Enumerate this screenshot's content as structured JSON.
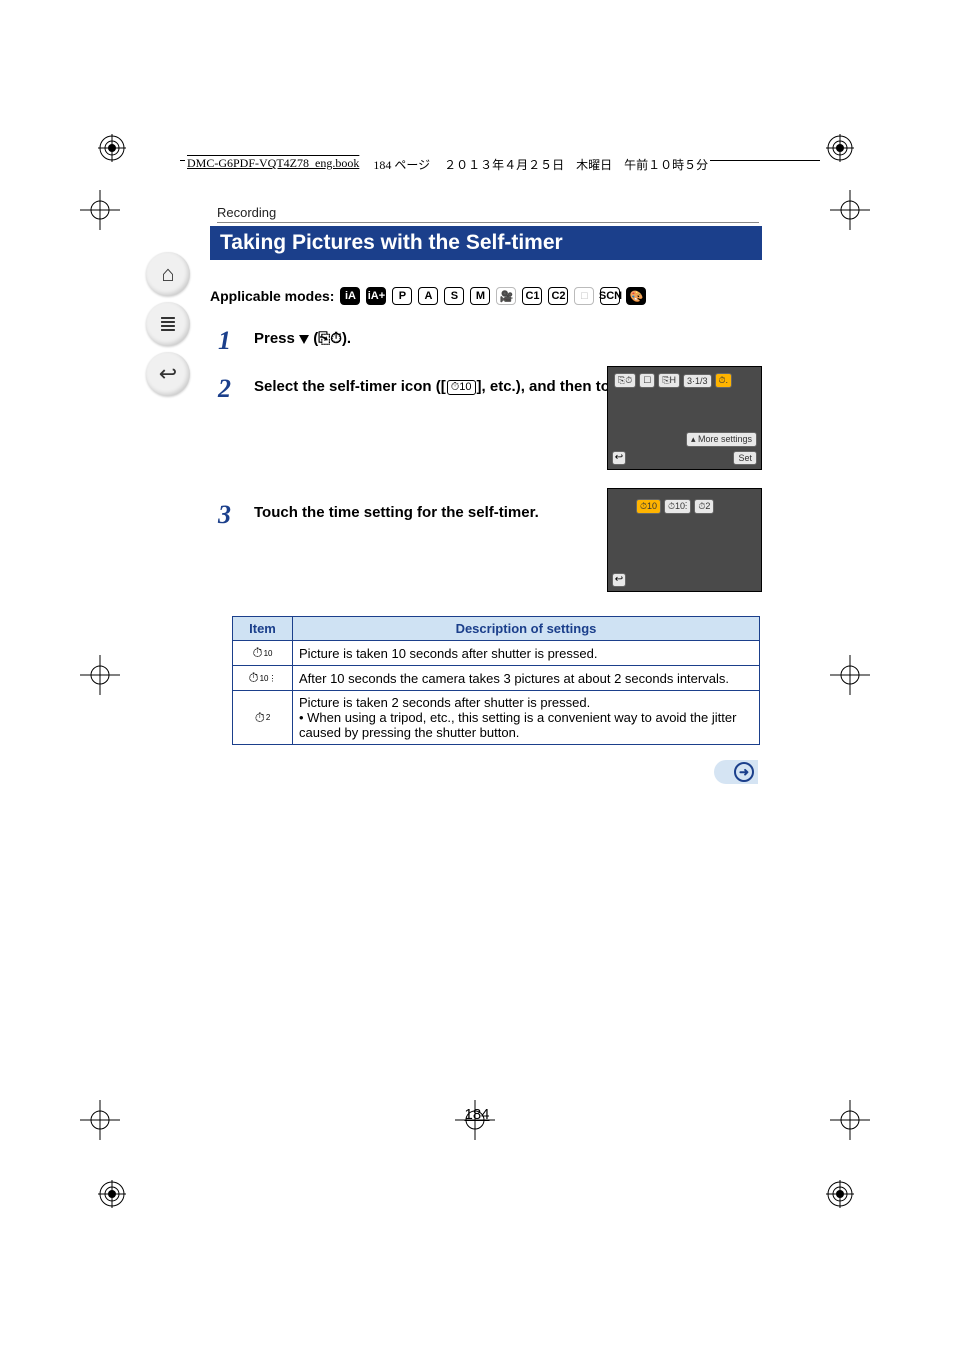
{
  "header": {
    "filename": "DMC-G6PDF-VQT4Z78_eng.book",
    "page_jp": "184 ページ",
    "date_jp": "２０１３年４月２５日　木曜日　午前１０時５分"
  },
  "breadcrumb": "Recording",
  "title": "Taking Pictures with the Self-timer",
  "modes_label": "Applicable modes:",
  "mode_chips": [
    "iA",
    "iA+",
    "P",
    "A",
    "S",
    "M",
    "🎥",
    "C1",
    "C2",
    "□",
    "SCN",
    "🎨"
  ],
  "steps": {
    "s1": {
      "num": "1",
      "text_pre": "Press ",
      "text_post": " (",
      "chip_burst": "⎘",
      "chip_timer": "⏱",
      "text_end": ")."
    },
    "s2": {
      "num": "2",
      "text_pre": "Select the self-timer icon ([",
      "chip": "⏱10",
      "text_post": "], etc.), and then touch [More settings]."
    },
    "s3": {
      "num": "3",
      "text": "Touch the time setting for the self-timer."
    }
  },
  "lcd1": {
    "top_chips": [
      "⎘⏱",
      "☐",
      "⎘H",
      "3·1/3",
      "⏱."
    ],
    "more": "More settings",
    "set": "Set",
    "back": "↩"
  },
  "lcd2": {
    "chips": [
      "⏱10",
      "⏱10⋮",
      "⏱2"
    ],
    "back": "↩"
  },
  "table": {
    "head_item": "Item",
    "head_desc": "Description of settings",
    "rows": [
      {
        "icon": "⏱",
        "sub": "10",
        "desc": "Picture is taken 10 seconds after shutter is pressed."
      },
      {
        "icon": "⏱",
        "sub": "10⋮",
        "desc": "After 10 seconds the camera takes 3 pictures at about 2 seconds intervals."
      },
      {
        "icon": "⏱",
        "sub": "2",
        "desc": "Picture is taken 2 seconds after shutter is pressed.\n• When using a tripod, etc., this setting is a convenient way to avoid the jitter caused by pressing the shutter button."
      }
    ]
  },
  "page_number": "184",
  "sidetabs": {
    "home": "⌂",
    "menu": "≣",
    "back": "↩"
  },
  "next_arrow": "➜"
}
